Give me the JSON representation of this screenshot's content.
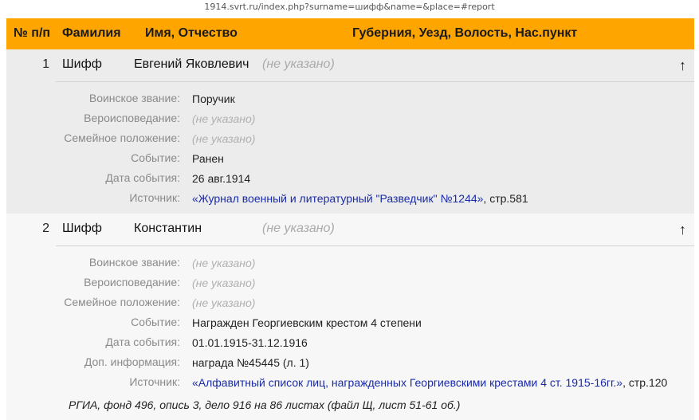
{
  "url": "1914.svrt.ru/index.php?surname=шифф&name=&place=#report",
  "header": {
    "num": "№ п/п",
    "surname": "Фамилия",
    "name": "Имя, Отчество",
    "place": "Губерния, Уезд, Волость, Нас.пункт"
  },
  "labels": {
    "rank": "Воинское звание:",
    "religion": "Вероисповедание:",
    "marital": "Семейное положение:",
    "event": "Событие:",
    "event_date": "Дата события:",
    "extra": "Доп. информация:",
    "source": "Источник:"
  },
  "up_arrow": "↑",
  "records": [
    {
      "num": "1",
      "surname": "Шифф",
      "name": "Евгений Яковлевич",
      "place": "(не указано)",
      "rank": "Поручик",
      "religion": "(не указано)",
      "marital": "(не указано)",
      "event": "Ранен",
      "event_date": "26 авг.1914",
      "source_link": "«Журнал военный и литературный \"Разведчик\" №1244»",
      "source_page": ", стр.581"
    },
    {
      "num": "2",
      "surname": "Шифф",
      "name": "Константин",
      "place": "(не указано)",
      "rank": "(не указано)",
      "religion": "(не указано)",
      "marital": "(не указано)",
      "event": "Награжден Георгиевским крестом 4 степени",
      "event_date": "01.01.1915-31.12.1916",
      "extra": "награда №45445 (л. 1)",
      "source_link": "«Алфавитный список лиц, награжденных Георгиевскими крестами 4 ст. 1915-16гг.»",
      "source_page": ", стр.120",
      "archive": "РГИА, фонд 496, опись 3, дело 916 на 86 листах (файл Щ, лист 51-61 об.)"
    }
  ]
}
